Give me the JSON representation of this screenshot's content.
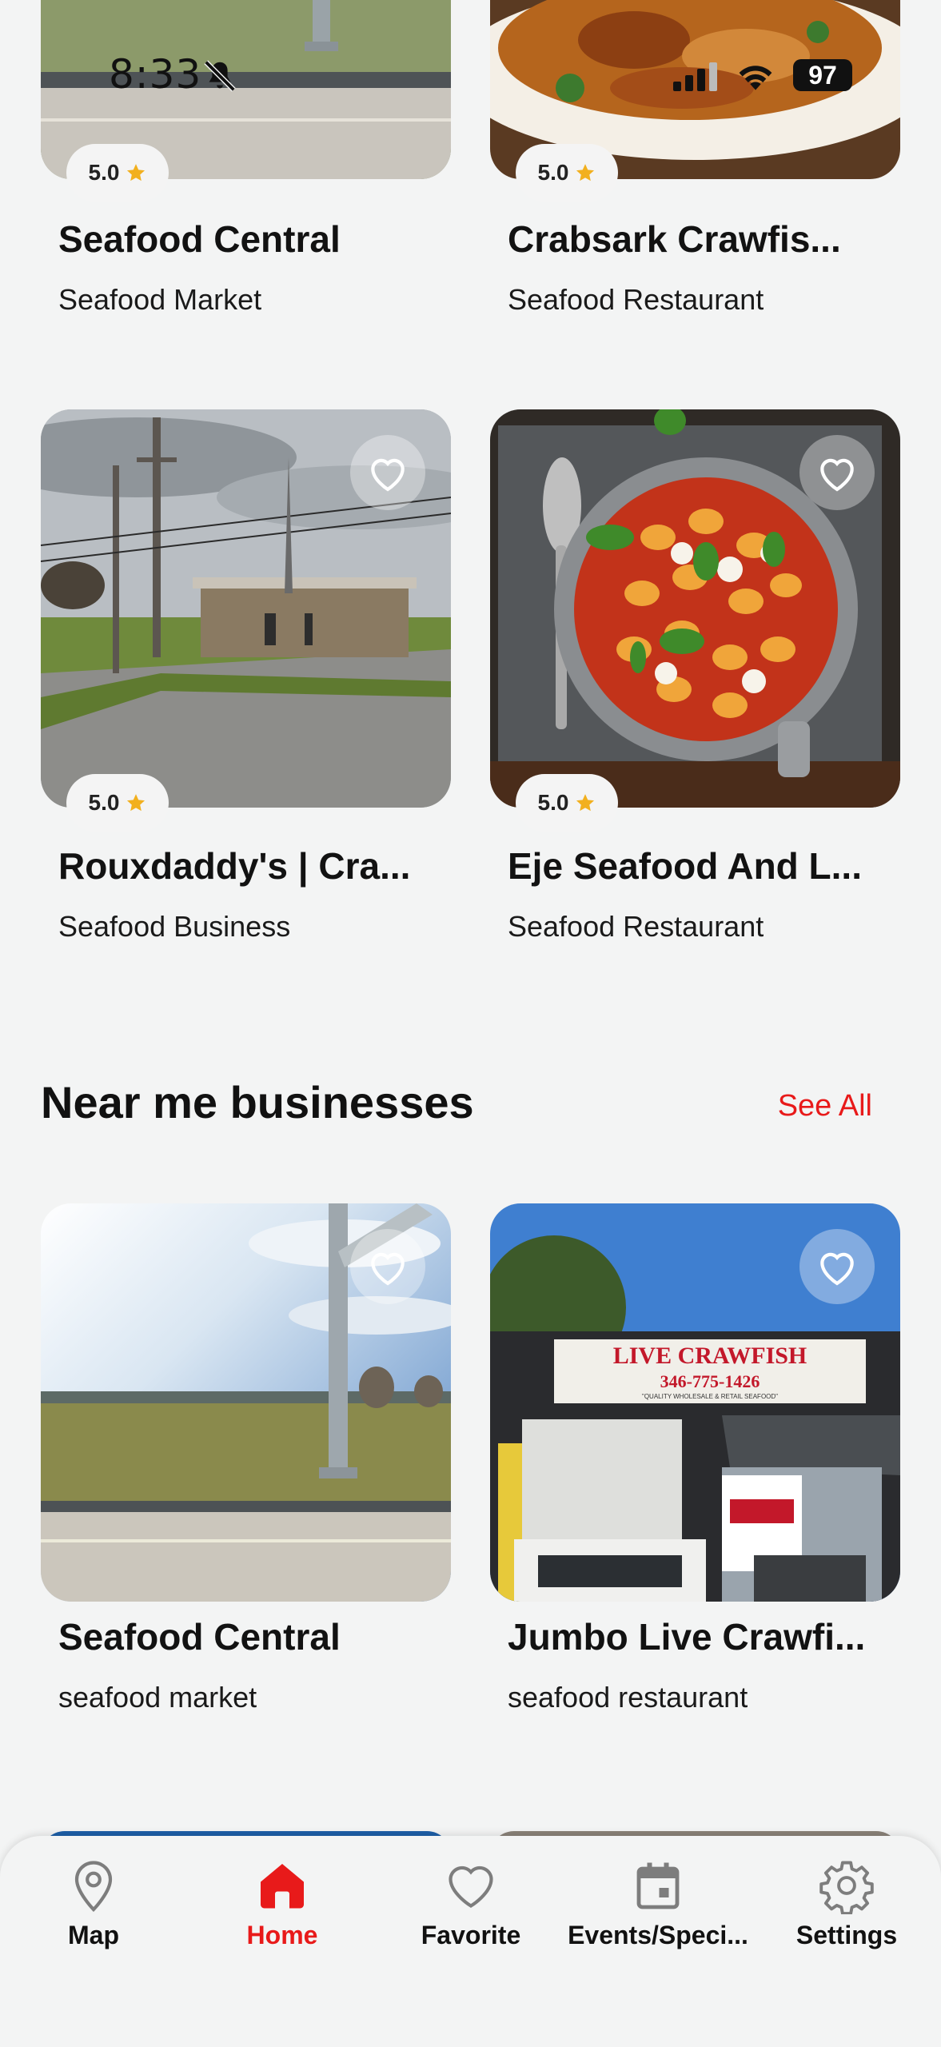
{
  "status_bar": {
    "time": "8:33",
    "battery": "97"
  },
  "top_row": [
    {
      "rating": "5.0",
      "title": "Seafood Central",
      "subtitle": "Seafood Market"
    },
    {
      "rating": "5.0",
      "title": "Crabsark Crawfis...",
      "subtitle": "Seafood Restaurant"
    }
  ],
  "second_row": [
    {
      "rating": "5.0",
      "title": "Rouxdaddy's | Cra...",
      "subtitle": "Seafood Business"
    },
    {
      "rating": "5.0",
      "title": "Eje Seafood And L...",
      "subtitle": "Seafood Restaurant"
    }
  ],
  "near_me": {
    "title": "Near me businesses",
    "see_all": "See All",
    "items": [
      {
        "title": "Seafood Central",
        "subtitle": "seafood market"
      },
      {
        "title": "Jumbo Live Crawfi...",
        "subtitle": "seafood restaurant",
        "sign_text": "LIVE CRAWFISH",
        "sign_phone": "346-775-1426",
        "sign_tagline": "\"QUALITY WHOLESALE & RETAIL SEAFOOD\""
      }
    ]
  },
  "bottom_nav": [
    {
      "label": "Map",
      "icon": "map-pin-icon"
    },
    {
      "label": "Home",
      "icon": "home-icon",
      "active": true
    },
    {
      "label": "Favorite",
      "icon": "heart-icon"
    },
    {
      "label": "Events/Speci...",
      "icon": "calendar-icon"
    },
    {
      "label": "Settings",
      "icon": "gear-icon"
    }
  ],
  "colors": {
    "accent": "#e81a1a",
    "star": "#f2b01e",
    "background": "#f3f4f4"
  }
}
